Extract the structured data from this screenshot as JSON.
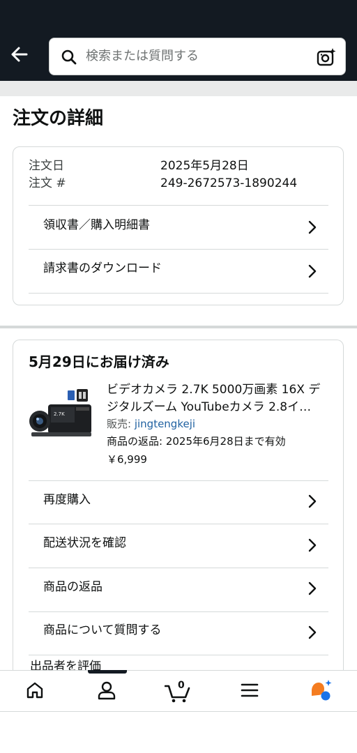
{
  "search": {
    "placeholder": "検索または質問する"
  },
  "page": {
    "title": "注文の詳細"
  },
  "order": {
    "date_label": "注文日",
    "date_value": "2025年5月28日",
    "number_label": "注文 #",
    "number_value": "249-2672573-1890244",
    "links": [
      {
        "label": "領収書／購入明細書"
      },
      {
        "label": "請求書のダウンロード"
      }
    ]
  },
  "shipment": {
    "status": "5月29日にお届け済み",
    "product": {
      "title_line1": "ビデオカメラ 2.7K 5000万画素 16X デ",
      "title_line2": "ジタルズーム YouTubeカメラ 2.8イ…",
      "seller_label": "販売: ",
      "seller_name": "jingtengkeji",
      "returns": "商品の返品: 2025年6月28日まで有効",
      "price": "￥6,999"
    },
    "actions": [
      {
        "label": "再度購入"
      },
      {
        "label": "配送状況を確認"
      },
      {
        "label": "商品の返品"
      },
      {
        "label": "商品について質問する"
      },
      {
        "label": "出品者を評価"
      }
    ]
  },
  "bottom_nav": {
    "items": [
      "home-icon",
      "account-icon",
      "cart-icon",
      "menu-icon",
      "rufus-icon"
    ],
    "cart_count": "0",
    "active_index": 1
  },
  "colors": {
    "header_bg": "#131a22",
    "link": "#2162a1",
    "rufus_orange": "#f47c20",
    "rufus_blue": "#1a73e8"
  }
}
